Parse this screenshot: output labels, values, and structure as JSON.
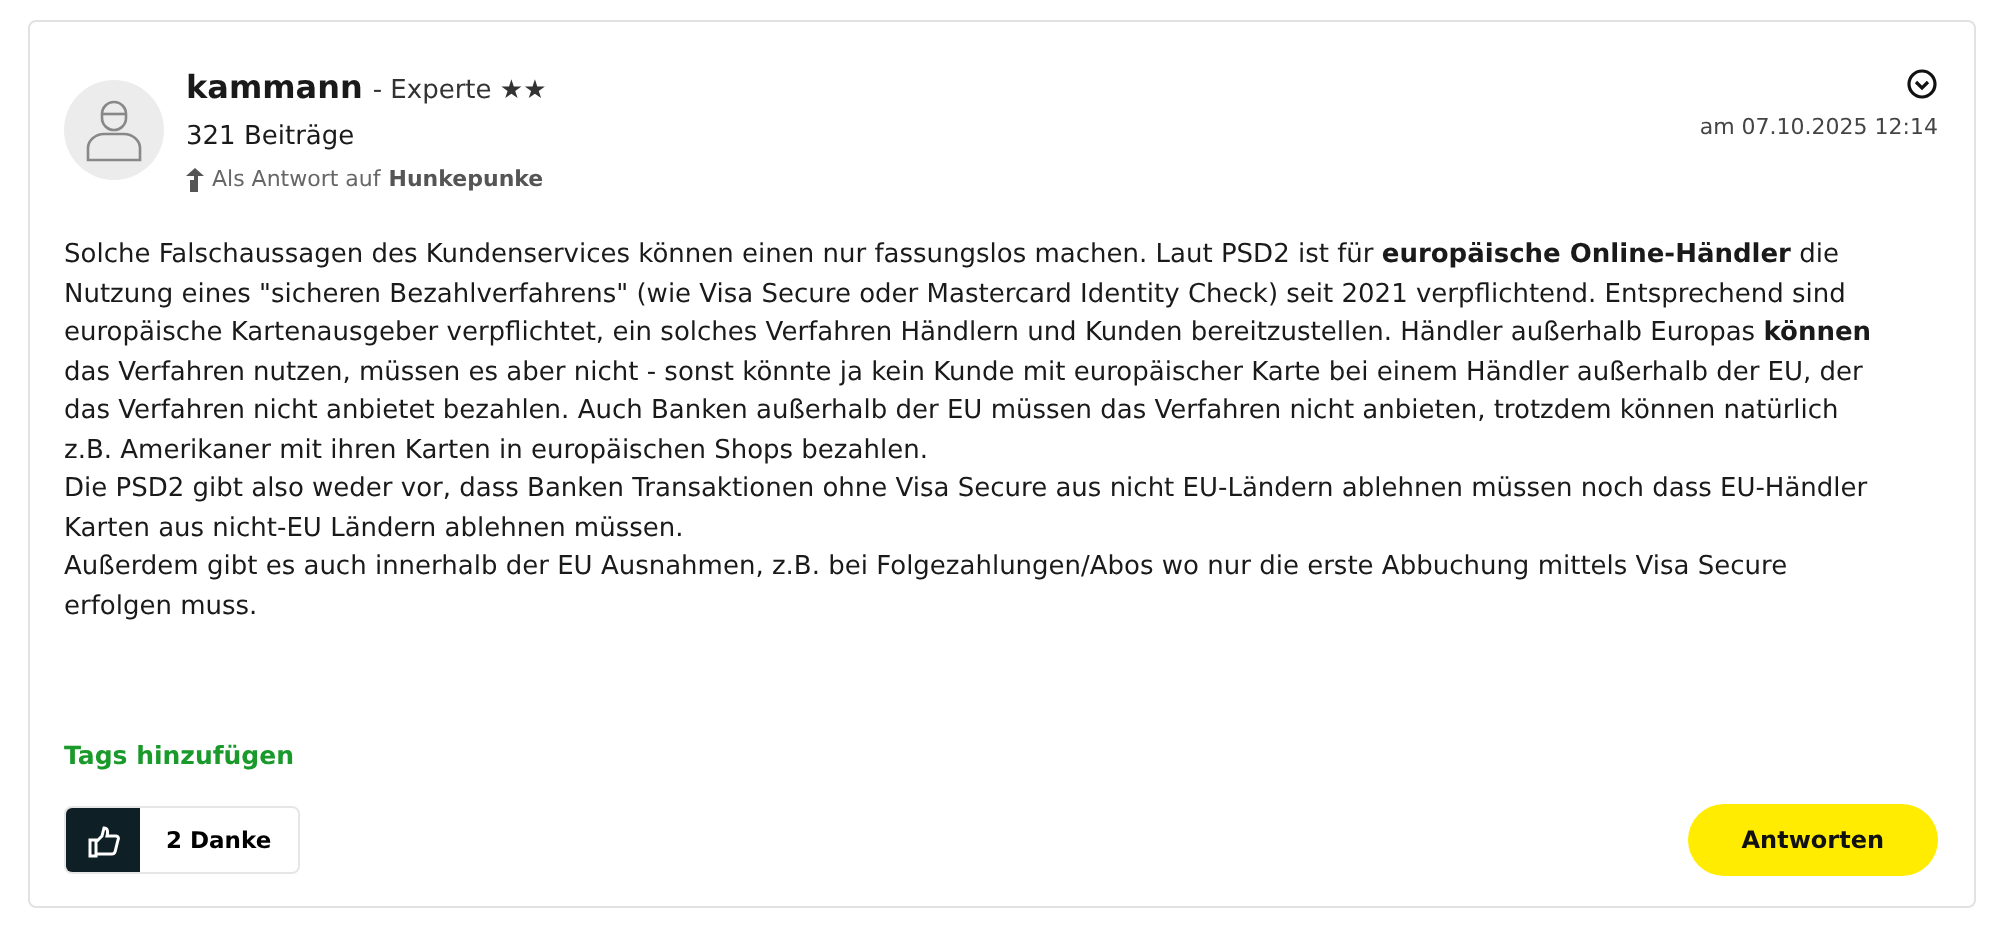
{
  "post": {
    "author": "kammann",
    "rank": "- Experte ★★",
    "posts": "321 Beiträge",
    "reply_prefix": "Als Antwort auf",
    "reply_to": "Hunkepunke",
    "date": "am 07.10.2025 12:14",
    "paragraphs": [
      "Solche Falschaussagen des Kundenservices können einen nur fassungslos machen. Laut PSD2 ist für **europäische Online-Händler** die Nutzung eines \"sicheren Bezahlverfahrens\" (wie Visa Secure oder Mastercard Identity Check) seit 2021 verpflichtend. Entsprechend sind europäische Kartenausgeber verpflichtet, ein solches Verfahren Händlern und Kunden bereitzustellen. Händler außerhalb Europas **können** das Verfahren nutzen, müssen es aber nicht - sonst könnte ja kein Kunde mit europäischer Karte bei einem Händler außerhalb der EU, der das Verfahren nicht anbietet bezahlen. Auch Banken außerhalb der EU müssen das Verfahren nicht anbieten, trotzdem können natürlich z.B. Amerikaner mit ihren Karten in europäischen Shops bezahlen.",
      "Die PSD2 gibt also weder vor, dass Banken Transaktionen ohne Visa Secure aus nicht EU-Ländern ablehnen müssen noch  dass EU-Händler Karten aus nicht-EU Ländern ablehnen müssen.",
      "Außerdem gibt es auch innerhalb der EU Ausnahmen, z.B. bei Folgezahlungen/Abos wo nur die erste Abbuchung mittels Visa Secure erfolgen muss."
    ],
    "tags_link": "Tags hinzufügen",
    "kudos": {
      "count": "2 Danke",
      "given": false
    },
    "reply_button": "Antworten"
  }
}
